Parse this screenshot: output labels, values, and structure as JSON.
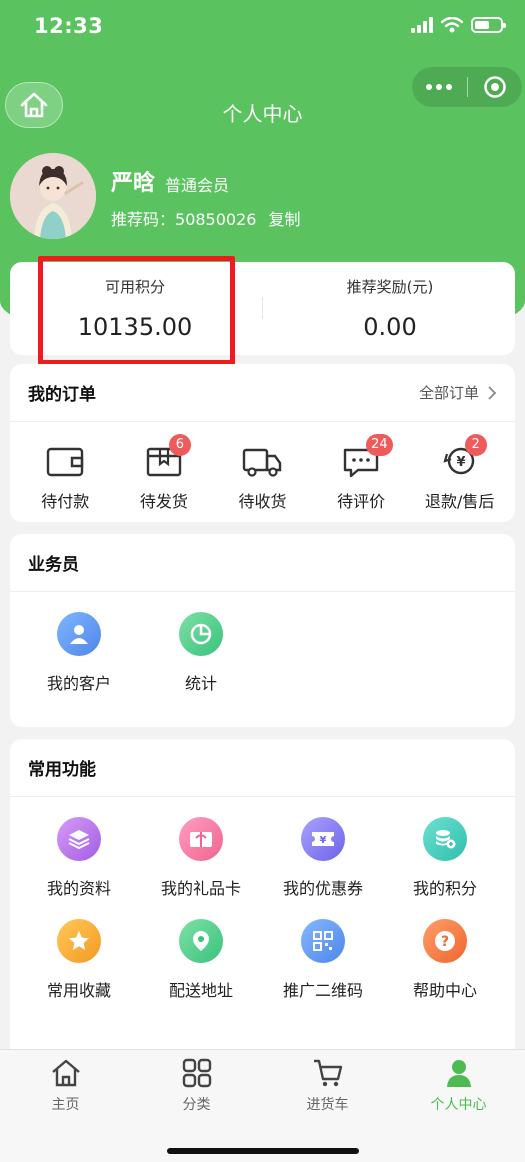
{
  "status_bar": {
    "time": "12:33"
  },
  "nav": {
    "title": "个人中心"
  },
  "profile": {
    "username": "严晗",
    "level": "普通会员",
    "ref_label": "推荐码：",
    "ref_code": "50850026",
    "copy_label": "复制"
  },
  "points": {
    "available_label": "可用积分",
    "available_value": "10135.00",
    "reward_label": "推荐奖励(元)",
    "reward_value": "0.00"
  },
  "orders": {
    "title": "我的订单",
    "all_label": "全部订单",
    "items": [
      {
        "label": "待付款",
        "badge": ""
      },
      {
        "label": "待发货",
        "badge": "6"
      },
      {
        "label": "待收货",
        "badge": ""
      },
      {
        "label": "待评价",
        "badge": "24"
      },
      {
        "label": "退款/售后",
        "badge": "2"
      }
    ]
  },
  "salesman": {
    "title": "业务员",
    "items": [
      {
        "label": "我的客户"
      },
      {
        "label": "统计"
      }
    ]
  },
  "common": {
    "title": "常用功能",
    "items": [
      {
        "label": "我的资料"
      },
      {
        "label": "我的礼品卡"
      },
      {
        "label": "我的优惠券"
      },
      {
        "label": "我的积分"
      },
      {
        "label": "常用收藏"
      },
      {
        "label": "配送地址"
      },
      {
        "label": "推广二维码"
      },
      {
        "label": "帮助中心"
      }
    ]
  },
  "tabbar": {
    "items": [
      {
        "label": "主页"
      },
      {
        "label": "分类"
      },
      {
        "label": "进货车"
      },
      {
        "label": "个人中心"
      }
    ],
    "active_color": "#4dbb52"
  },
  "colors": {
    "brand": "#5ac35f",
    "badge": "#ef5b5b",
    "highlight": "#ee1c1c"
  }
}
